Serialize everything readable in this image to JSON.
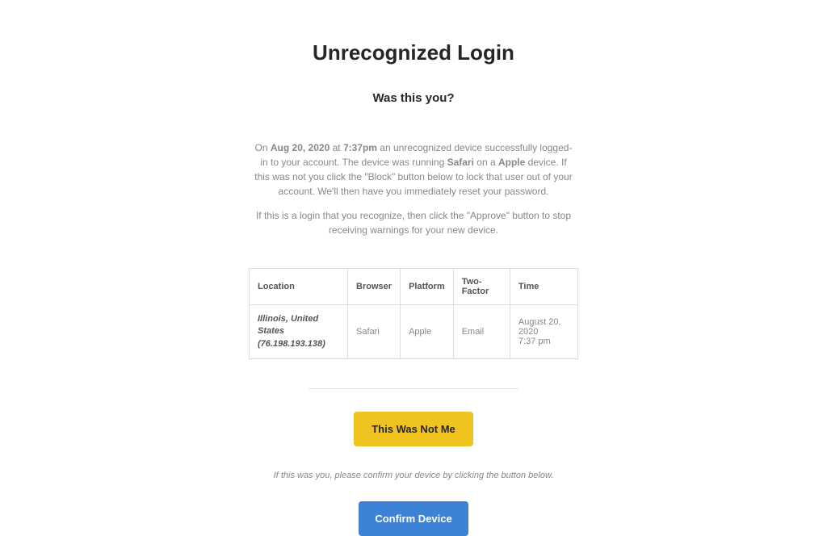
{
  "title": "Unrecognized Login",
  "subtitle": "Was this you?",
  "paragraph1": {
    "prefix": "On ",
    "date": "Aug 20, 2020",
    "at": " at ",
    "time": "7:37pm",
    "mid1": " an unrecognized device successfully logged-in to your account. The device was running ",
    "browser": "Safari",
    "mid2": " on a ",
    "platform": "Apple",
    "suffix": " device. If this was not you click the \"Block\" button below to lock that user out of your account. We'll then have you immediately reset your password."
  },
  "paragraph2": "If this is a login that you recognize, then click the \"Approve\" button to stop receiving warnings for your new device.",
  "table": {
    "headers": {
      "location": "Location",
      "browser": "Browser",
      "platform": "Platform",
      "twofactor": "Two-Factor",
      "time": "Time"
    },
    "row": {
      "location_line1": "Illinois, United States",
      "location_line2": "(76.198.193.138)",
      "browser": "Safari",
      "platform": "Apple",
      "twofactor": "Email",
      "time_line1": "August 20, 2020",
      "time_line2": "7:37 pm"
    }
  },
  "button_not_me": "This Was Not Me",
  "confirm_text": "If this was you, please confirm your device by clicking the button below.",
  "button_confirm": "Confirm Device"
}
